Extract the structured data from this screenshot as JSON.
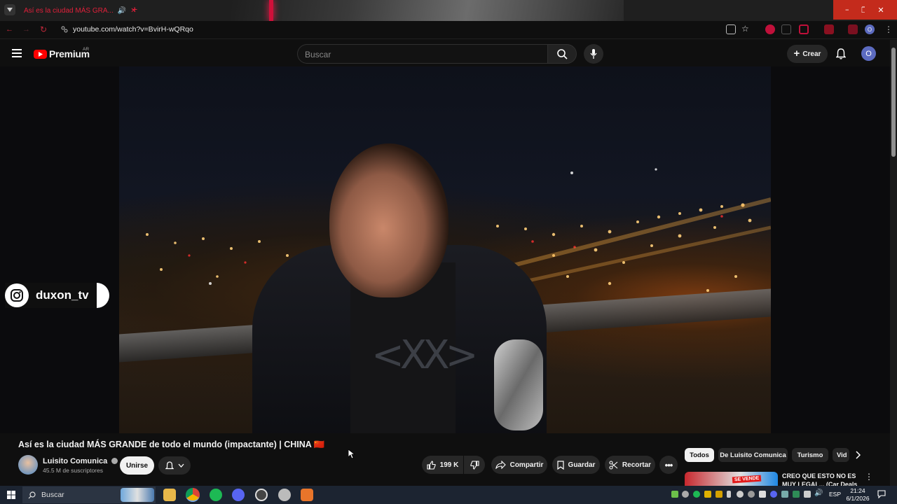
{
  "browser": {
    "tab_title": "Así es la ciudad MÁS GRA...",
    "url": "youtube.com/watch?v=BvirH-wQRqo",
    "profile_initial": "O"
  },
  "header": {
    "logo_text": "Premium",
    "region": "AR",
    "search_placeholder": "Buscar",
    "create_label": "Crear",
    "avatar_initial": "O"
  },
  "video": {
    "overlay_handle": "duxon_tv"
  },
  "info": {
    "title": "Así es la ciudad MÁS GRANDE de todo el mundo (impactante) | CHINA 🇨🇳",
    "channel_name": "Luisito Comunica",
    "subscribers": "45.5 M de suscriptores",
    "join_label": "Unirse",
    "likes": "199 K",
    "share_label": "Compartir",
    "save_label": "Guardar",
    "clip_label": "Recortar"
  },
  "sidebar": {
    "chips": [
      "Todos",
      "De Luisito Comunica",
      "Turismo",
      "Vid"
    ],
    "video_title": "CREO QUE ESTO NO ES MUY LEGAL... (Car Deals",
    "thumb_badge": "SE VENDE"
  },
  "taskbar": {
    "search_label": "Buscar",
    "language": "ESP",
    "time": "21:24",
    "date": "6/1/2026"
  },
  "colors": {
    "yt_red": "#ff0000",
    "background": "#0f0f0f",
    "chip_active_bg": "#f1f1f1",
    "avatar_bg": "#5c6bc0"
  }
}
